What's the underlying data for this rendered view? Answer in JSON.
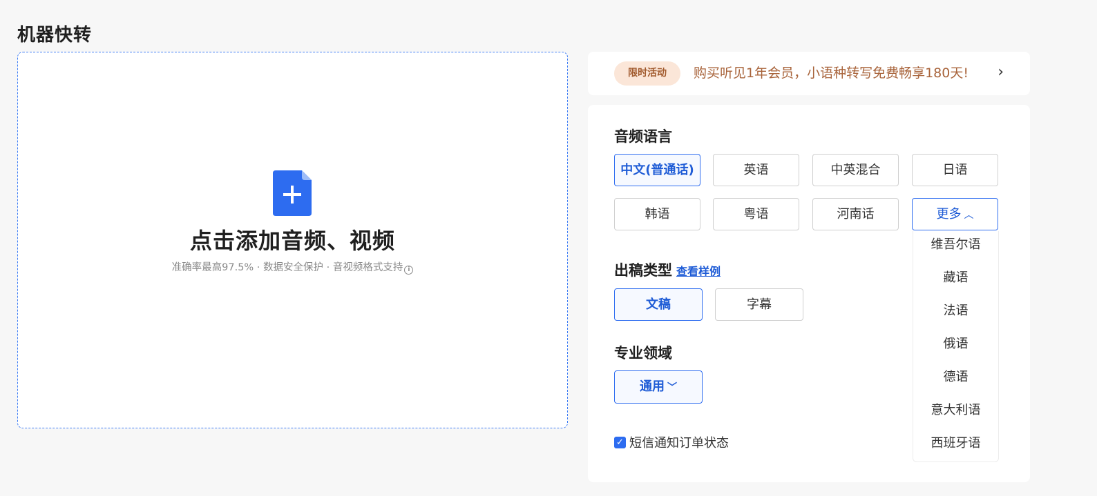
{
  "page": {
    "title": "机器快转"
  },
  "upload": {
    "title": "点击添加音频、视频",
    "subtitle": "准确率最高97.5% · 数据安全保护 · 音视频格式支持"
  },
  "promo": {
    "badge": "限时活动",
    "text": "购买听见1年会员，小语种转写免费畅享180天!",
    "chevron": "›"
  },
  "audio_language": {
    "title": "音频语言",
    "options": [
      "中文(普通话)",
      "英语",
      "中英混合",
      "日语",
      "韩语",
      "粤语",
      "河南话"
    ],
    "selected": "中文(普通话)",
    "more_label": "更多",
    "more_options": [
      "维吾尔语",
      "藏语",
      "法语",
      "俄语",
      "德语",
      "意大利语",
      "西班牙语"
    ]
  },
  "output_type": {
    "title": "出稿类型",
    "sample_link": "查看样例",
    "options": [
      "文稿",
      "字幕"
    ],
    "selected": "文稿"
  },
  "domain_field": {
    "title": "专业领域",
    "selected_label": "通用"
  },
  "sms": {
    "label": "短信通知订单状态",
    "checked": true
  },
  "colors": {
    "accent": "#2d6cf0",
    "promo_text": "#a8633a",
    "promo_badge_bg": "#fbe6d8"
  }
}
